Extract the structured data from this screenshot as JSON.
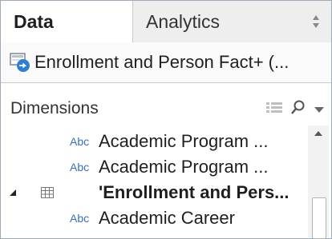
{
  "tabs": [
    {
      "label": "Data",
      "active": true
    },
    {
      "label": "Analytics",
      "active": false
    }
  ],
  "datasource": {
    "name": "Enrollment and Person Fact+ (..."
  },
  "dimensions": {
    "title": "Dimensions"
  },
  "fields": [
    {
      "type_badge": "Abc",
      "name": "Academic Program ...",
      "kind": "field"
    },
    {
      "type_badge": "Abc",
      "name": "Academic Program ...",
      "kind": "field"
    },
    {
      "type_badge": "",
      "name": "'Enrollment and Pers...",
      "kind": "folder"
    },
    {
      "type_badge": "Abc",
      "name": "Academic Career",
      "kind": "field"
    }
  ],
  "colors": {
    "accent_blue": "#3b6fb5",
    "border": "#9ea9b5"
  }
}
